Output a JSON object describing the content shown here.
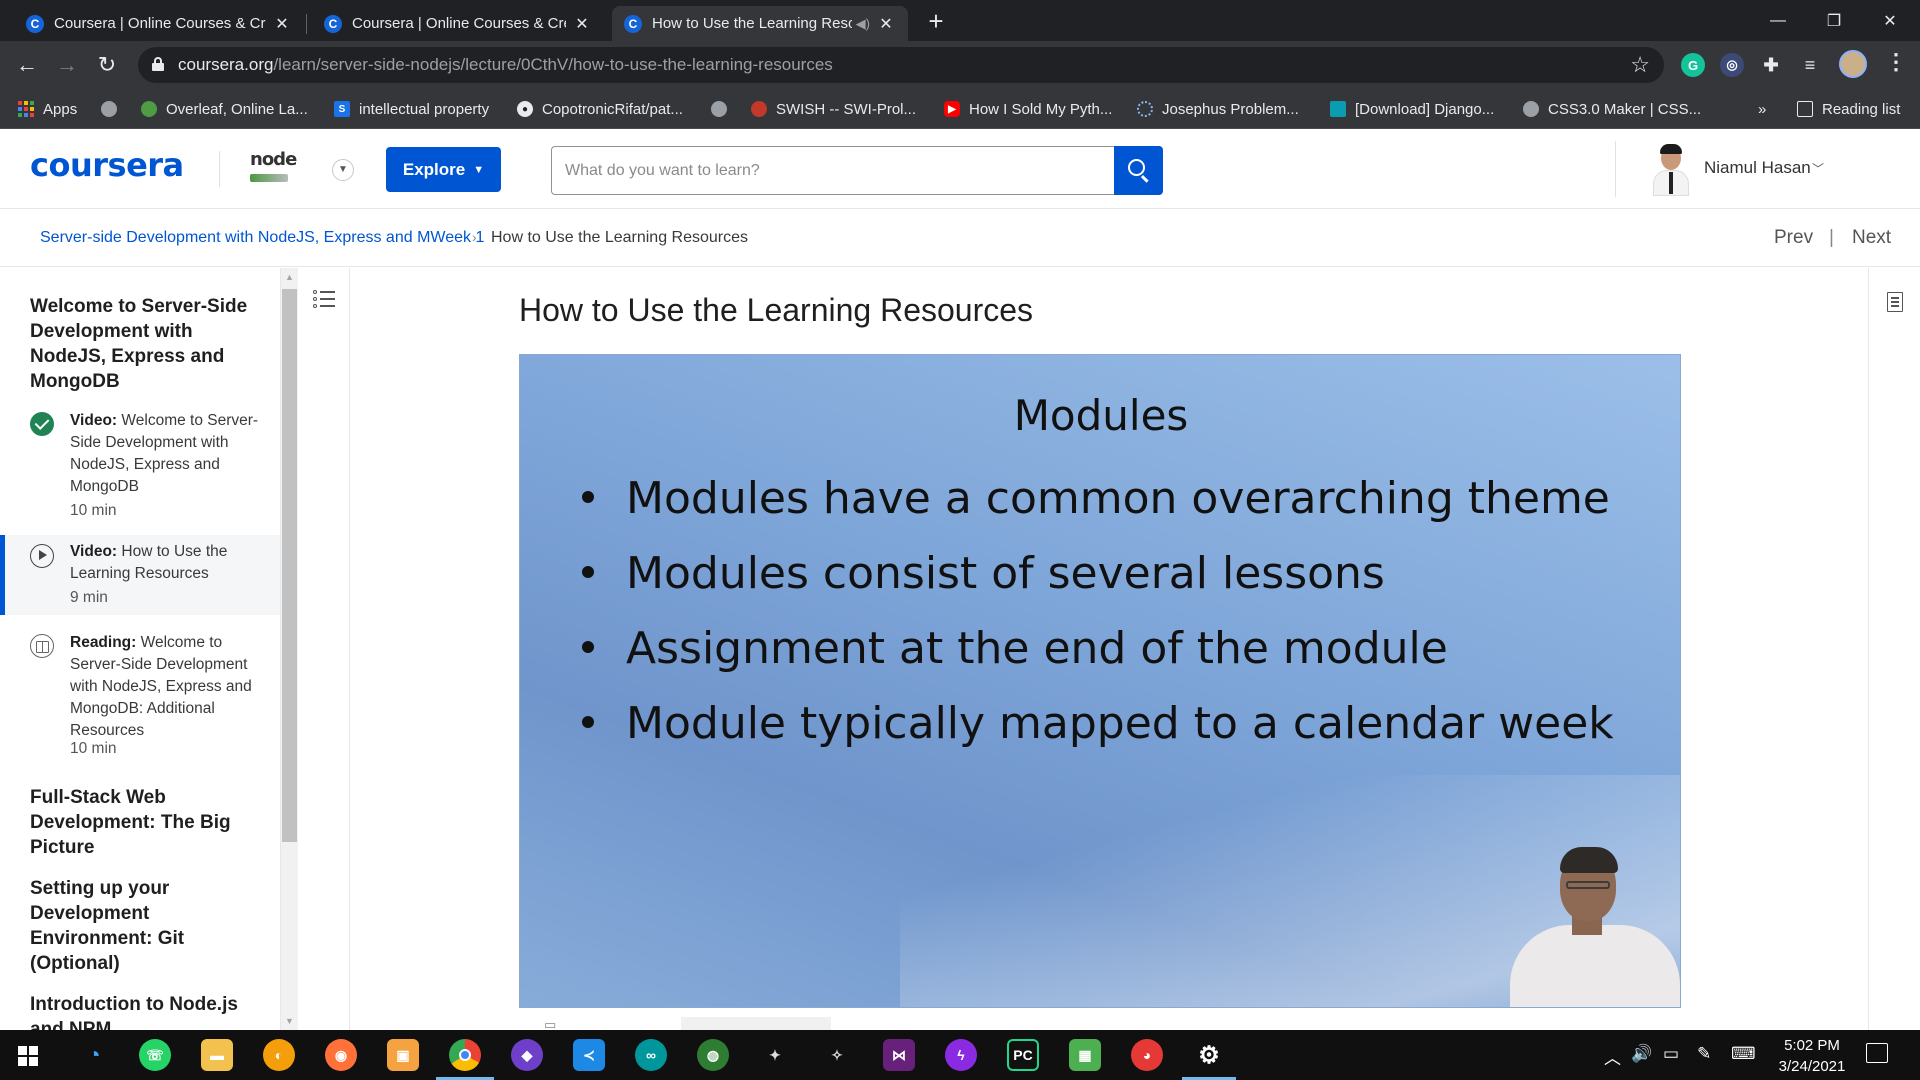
{
  "browser": {
    "tabs": [
      {
        "title": "Coursera | Online Courses & Credentials",
        "favicon": "C",
        "active": false
      },
      {
        "title": "Coursera | Online Courses & Credentials",
        "favicon": "C",
        "active": false
      },
      {
        "title": "How to Use the Learning Resources",
        "favicon": "C",
        "active": true
      }
    ],
    "new_tab_label": "+",
    "url_host": "coursera.org",
    "url_path": "/learn/server-side-nodejs/lecture/0CthV/how-to-use-the-learning-resources",
    "bookmarks": [
      {
        "label": "Apps",
        "icon": "apps-grid-icon"
      },
      {
        "label": "",
        "icon": "globe-icon"
      },
      {
        "label": "Overleaf, Online La...",
        "icon": "overleaf-icon"
      },
      {
        "label": "intellectual property",
        "icon": "bookmark-s-icon"
      },
      {
        "label": "CopotronicRifat/pat...",
        "icon": "github-icon"
      },
      {
        "label": "",
        "icon": "globe-icon"
      },
      {
        "label": "SWISH -- SWI-Prol...",
        "icon": "swish-icon"
      },
      {
        "label": "How I Sold My Pyth...",
        "icon": "youtube-icon"
      },
      {
        "label": "Josephus Problem...",
        "icon": "loading-icon"
      },
      {
        "label": "[Download] Django...",
        "icon": "django-icon"
      },
      {
        "label": "CSS3.0 Maker | CSS...",
        "icon": "globe-icon"
      }
    ],
    "more_bookmarks": "»",
    "reading_list": "Reading list"
  },
  "header": {
    "logo_text": "coursera",
    "org_logo_text": "node",
    "explore_label": "Explore",
    "search_placeholder": "What do you want to learn?",
    "user_name": "Niamul Hasan"
  },
  "breadcrumb": {
    "course_link": "Server-side Development with NodeJS, Express and MWeek 1",
    "separator": "›",
    "current": "How to Use the Learning Resources",
    "prev_label": "Prev",
    "pn_separator": "|",
    "next_label": "Next"
  },
  "sidebar": {
    "module1_title": "Welcome to Server-Side Development with NodeJS, Express and MongoDB",
    "items": [
      {
        "type_label": "Video:",
        "title": "Welcome to Server-Side Development with NodeJS, Express and MongoDB",
        "duration": "10 min",
        "status": "completed"
      },
      {
        "type_label": "Video:",
        "title": "How to Use the Learning Resources",
        "duration": "9 min",
        "status": "current"
      },
      {
        "type_label": "Reading:",
        "title": "Welcome to Server-Side Development with NodeJS, Express and MongoDB: Additional Resources",
        "duration": "10 min",
        "status": "not-started"
      }
    ],
    "modules": [
      "Full-Stack Web Development: The Big Picture",
      "Setting up your Development Environment: Git (Optional)",
      "Introduction to Node.js and NPM"
    ]
  },
  "lesson": {
    "title": "How to Use the Learning Resources",
    "slide_title": "Modules",
    "slide_bullets": [
      "Modules have a common overarching theme",
      "Modules consist of several lessons",
      "Assignment at the end of the module",
      "Module typically mapped to a calendar week"
    ]
  },
  "taskbar": {
    "time": "5:02 PM",
    "date": "3/24/2021"
  },
  "colors": {
    "coursera_blue": "#0056d2",
    "completed_green": "#1f8354",
    "chrome_dark": "#202124",
    "chrome_toolbar": "#35363a",
    "taskbar": "#101010"
  }
}
